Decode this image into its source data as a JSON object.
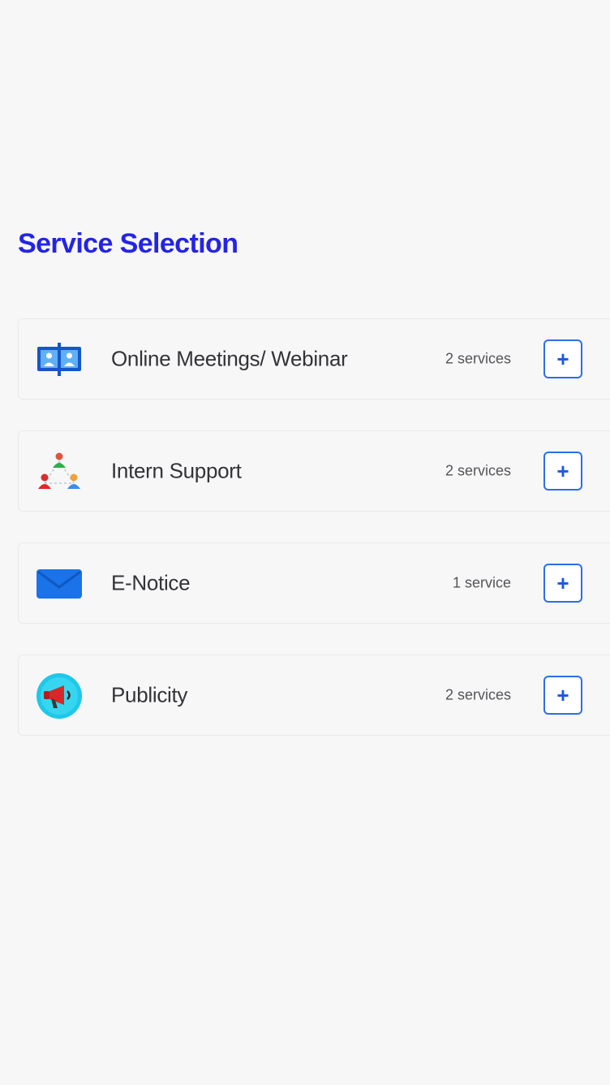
{
  "page": {
    "title": "Service Selection"
  },
  "colors": {
    "title": "#2424e6",
    "accent": "#2c6df0",
    "background": "#f7f7f8"
  },
  "services": [
    {
      "name": "Online Meetings/ Webinar",
      "count": "2 services",
      "icon": "video-conference-icon",
      "add_label": "+"
    },
    {
      "name": "Intern Support",
      "count": "2 services",
      "icon": "team-network-icon",
      "add_label": "+"
    },
    {
      "name": "E-Notice",
      "count": "1 service",
      "icon": "mail-envelope-icon",
      "add_label": "+"
    },
    {
      "name": "Publicity",
      "count": "2 services",
      "icon": "megaphone-icon",
      "add_label": "+"
    }
  ]
}
